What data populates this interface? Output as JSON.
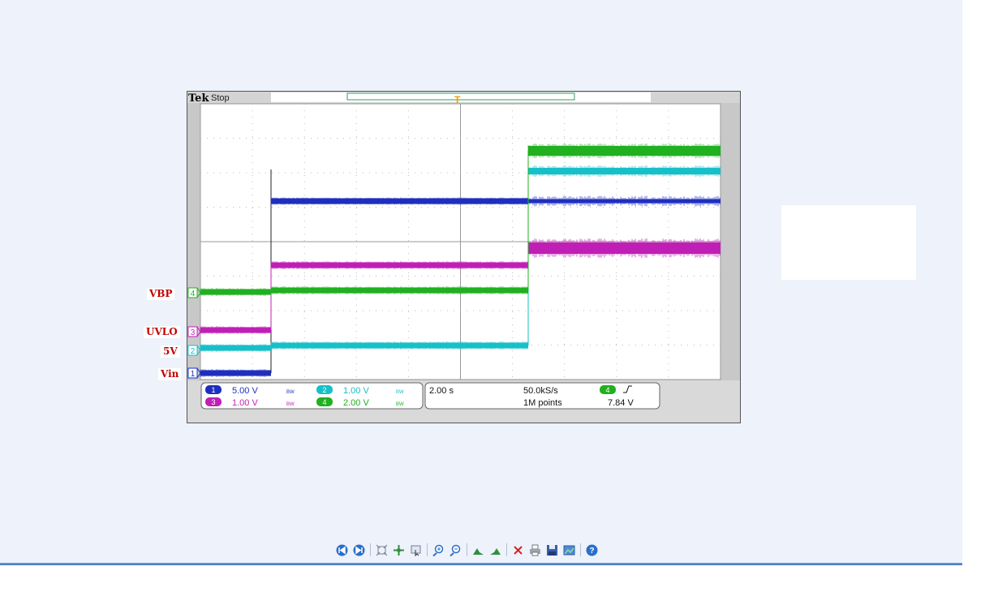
{
  "scope": {
    "brand": "Tek",
    "status": "Stop",
    "trigger_marker": "T",
    "channels": [
      {
        "id": "1",
        "scale": "5.00 V",
        "color": "#1e2fbf",
        "label_color": "#0e1fb0"
      },
      {
        "id": "2",
        "scale": "1.00 V",
        "color": "#17c0c8",
        "label_color": "#00a9b4"
      },
      {
        "id": "3",
        "scale": "1.00 V",
        "color": "#c01fb6",
        "label_color": "#a100a0"
      },
      {
        "id": "4",
        "scale": "2.00 V",
        "color": "#20b020",
        "label_color": "#0b8a0b"
      }
    ],
    "bw_icon": "BW",
    "timebase": "2.00 s",
    "sample_rate": "50.0kS/s",
    "record_length": "1M points",
    "trigger_channel": "4",
    "trigger_slope": "rising-edge",
    "trigger_level": "7.84 V"
  },
  "side_labels": {
    "vbp": "VBP",
    "uvlo": "UVLO",
    "v5": "5V",
    "vin": "Vin"
  },
  "toolbar": {
    "icons": [
      "first-page-icon",
      "next-page-icon",
      "fit-page-icon",
      "pan-icon",
      "select-icon",
      "zoom-in-icon",
      "zoom-out-icon",
      "rotate-left-icon",
      "rotate-right-icon",
      "delete-icon",
      "print-icon",
      "save-icon",
      "export-icon",
      "help-icon"
    ]
  }
}
